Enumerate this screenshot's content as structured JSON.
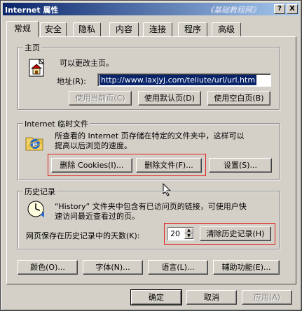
{
  "window": {
    "title": "Internet 属性",
    "watermark": "《基础教程网》",
    "help_button": "?",
    "close_button": "X"
  },
  "tabs": [
    "常规",
    "安全",
    "隐私",
    "内容",
    "连接",
    "程序",
    "高级"
  ],
  "active_tab": "常规",
  "home_page": {
    "group_label": "主页",
    "description": "可以更改主页。",
    "address_label": "地址(R):",
    "address_value": "http://www.laxjyj.com/teliute/url/url.htm",
    "btn_current": "使用当前页(C)",
    "btn_default": "使用默认页(D)",
    "btn_blank": "使用空白页(B)"
  },
  "temp_files": {
    "group_label": "Internet 临时文件",
    "description_line1": "所查看的 Internet 页存储在特定的文件夹中，这样可以",
    "description_line2": "提高以后浏览的速度。",
    "btn_delete_cookies": "删除 Cookies(I)...",
    "btn_delete_files": "删除文件(F)...",
    "btn_settings": "设置(S)..."
  },
  "history": {
    "group_label": "历史记录",
    "description_line1": "“History” 文件夹中包含有已访问页的链接，可使用户快",
    "description_line2": "速访问最近查看过的页。",
    "days_label": "网页保存在历史记录中的天数(K):",
    "days_value": "20",
    "btn_clear": "清除历史记录(H)"
  },
  "bottom_buttons": {
    "colors": "颜色(O)...",
    "fonts": "字体(N)...",
    "languages": "语言(L)...",
    "accessibility": "辅助功能(E)..."
  },
  "dialog_buttons": {
    "ok": "确定",
    "cancel": "取消",
    "apply": "应用(A)"
  },
  "colors": {
    "title_start": "#0a246a",
    "title_end": "#a6caf0",
    "face": "#d4d0c8",
    "highlight_box": "#e02020"
  }
}
